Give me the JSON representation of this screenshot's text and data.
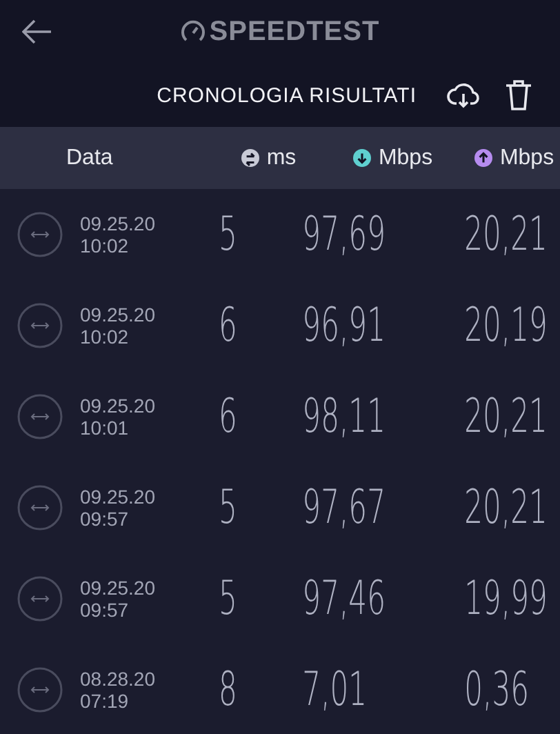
{
  "header": {
    "logo": "SPEEDTEST",
    "title": "CRONOLOGIA RISULTATI"
  },
  "columns": [
    {
      "kind": "date",
      "label": "Data"
    },
    {
      "kind": "ping",
      "label": "ms"
    },
    {
      "kind": "download",
      "label": "Mbps"
    },
    {
      "kind": "upload",
      "label": "Mbps"
    }
  ],
  "rows": [
    {
      "date": "09.25.20",
      "time": "10:02",
      "ms": "5",
      "download": "97,69",
      "upload": "20,21"
    },
    {
      "date": "09.25.20",
      "time": "10:02",
      "ms": "6",
      "download": "96,91",
      "upload": "20,19"
    },
    {
      "date": "09.25.20",
      "time": "10:01",
      "ms": "6",
      "download": "98,11",
      "upload": "20,21"
    },
    {
      "date": "09.25.20",
      "time": "09:57",
      "ms": "5",
      "download": "97,67",
      "upload": "20,21"
    },
    {
      "date": "09.25.20",
      "time": "09:57",
      "ms": "5",
      "download": "97,46",
      "upload": "19,99"
    },
    {
      "date": "08.28.20",
      "time": "07:19",
      "ms": "8",
      "download": "7,01",
      "upload": "0,36"
    }
  ]
}
